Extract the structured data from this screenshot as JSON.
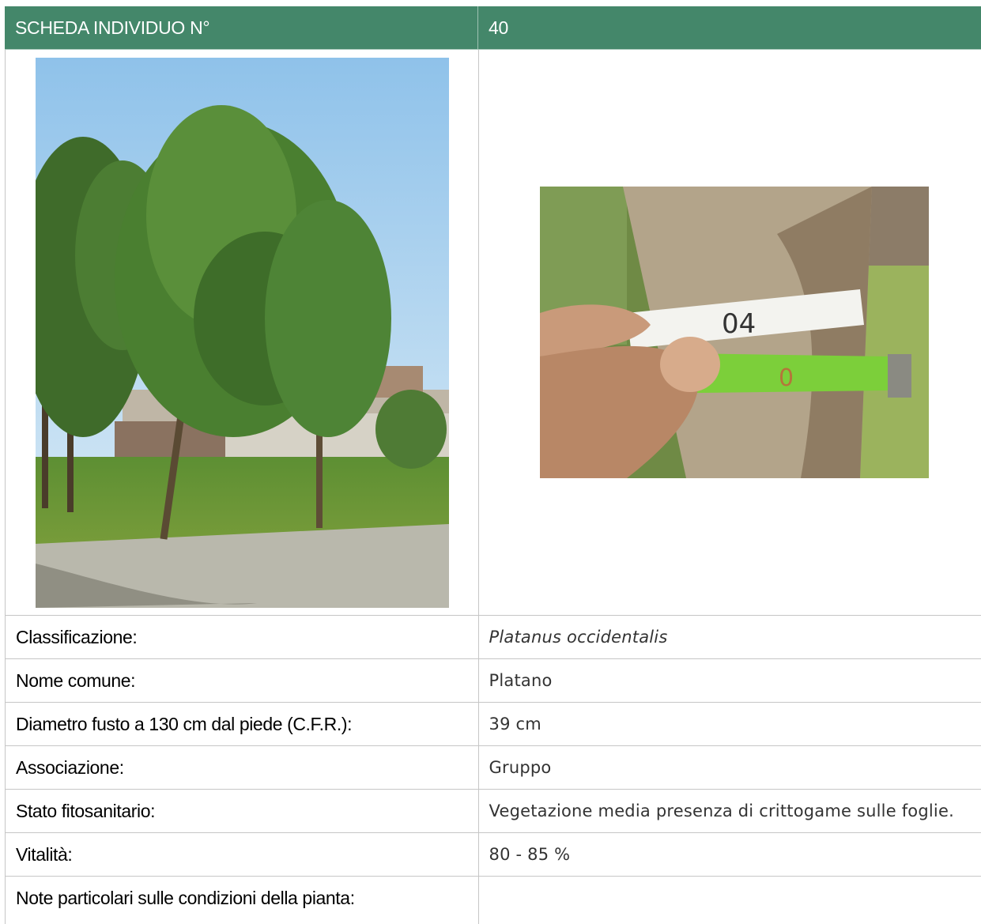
{
  "header": {
    "label": "SCHEDA INDIVIDUO N°",
    "number": "40"
  },
  "photos": {
    "tree_photo_icon": "tree-photo",
    "trunk_photo_icon": "trunk-measure-photo"
  },
  "rows": [
    {
      "label": "Classificazione:",
      "value": "Platanus occidentalis"
    },
    {
      "label": "Nome comune:",
      "value": "Platano"
    },
    {
      "label": "Diametro fusto a 130 cm dal piede (C.F.R.):",
      "value": "39 cm"
    },
    {
      "label": "Associazione:",
      "value": "Gruppo"
    },
    {
      "label": "Stato fitosanitario:",
      "value": "Vegetazione media presenza di crittogame sulle foglie."
    },
    {
      "label": "Vitalità:",
      "value": "80 - 85 %"
    },
    {
      "label": "Note particolari sulle condizioni della pianta:",
      "value": ""
    }
  ],
  "colors": {
    "header_bg": "#44876a",
    "border": "#c6c6c6"
  }
}
